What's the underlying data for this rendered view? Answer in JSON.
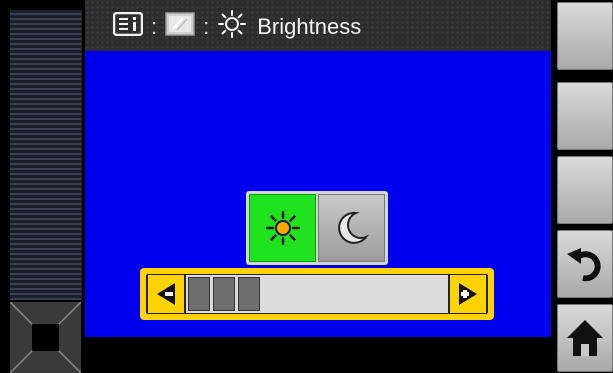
{
  "header": {
    "separator": ":",
    "title": "Brightness",
    "icons": [
      "info-menu-icon",
      "display-icon",
      "brightness-icon"
    ]
  },
  "mode_toggle": {
    "options": [
      "day-mode",
      "night-mode"
    ],
    "selected": "day-mode",
    "selected_color": "#1ee31e"
  },
  "slider": {
    "level_fraction": 0.3,
    "filled_segments": 3,
    "accent_color": "#ffd200"
  },
  "right_buttons": [
    "blank",
    "blank",
    "blank",
    "back-icon",
    "home-icon"
  ],
  "colors": {
    "main_background": "#0000ee",
    "header_background": "#2c2c2c"
  }
}
